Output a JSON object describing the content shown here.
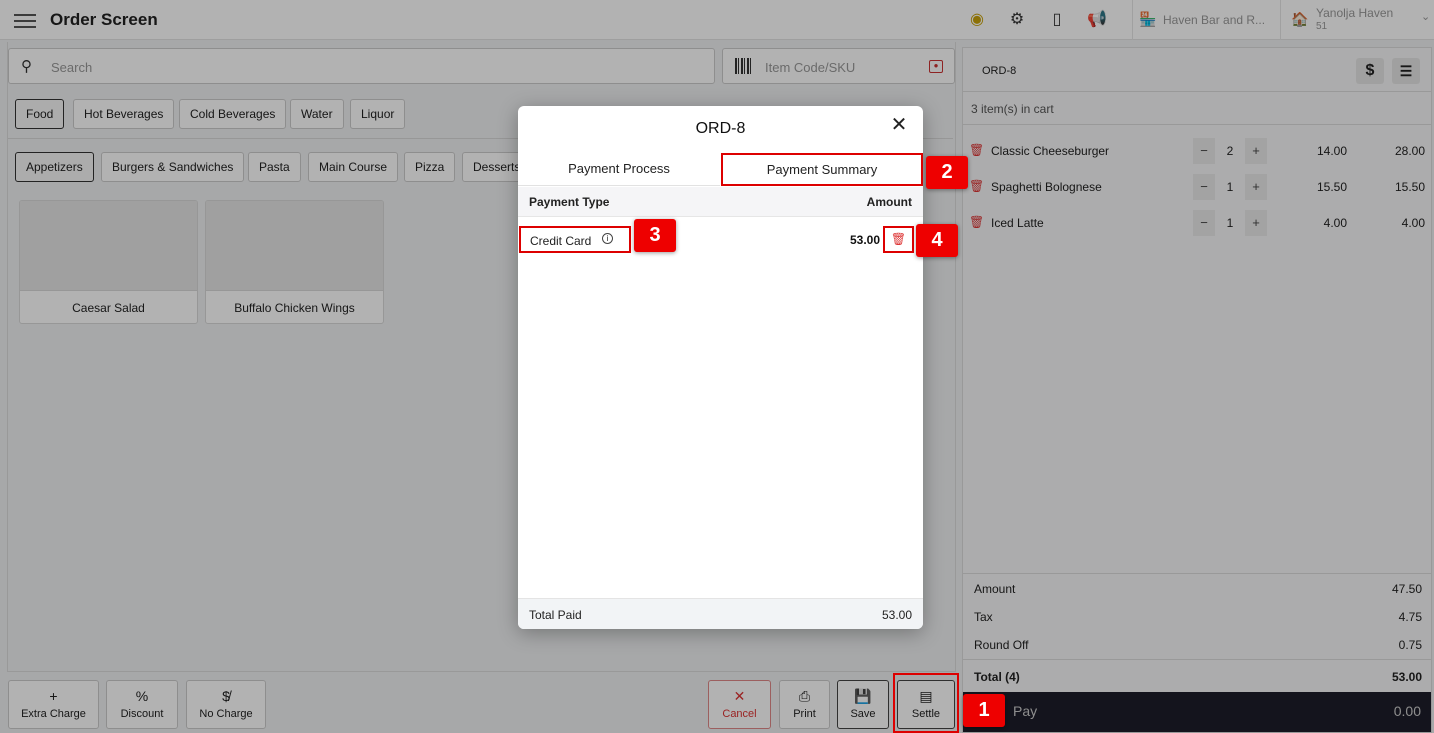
{
  "header": {
    "title": "Order Screen",
    "venue": "Haven Bar and R...",
    "property_name": "Yanolja Haven",
    "property_code": "51"
  },
  "search": {
    "placeholder": "Search",
    "sku_placeholder": "Item Code/SKU"
  },
  "categories": [
    "Food",
    "Hot Beverages",
    "Cold Beverages",
    "Water",
    "Liquor"
  ],
  "subcategories": [
    "Appetizers",
    "Burgers & Sandwiches",
    "Pasta",
    "Main Course",
    "Pizza",
    "Desserts"
  ],
  "products": [
    "Caesar Salad",
    "Buffalo Chicken Wings"
  ],
  "actions": {
    "extra_charge": "Extra Charge",
    "discount": "Discount",
    "no_charge": "No Charge",
    "cancel": "Cancel",
    "print": "Print",
    "save": "Save",
    "settle": "Settle"
  },
  "cart": {
    "order_id": "ORD-8",
    "count_text": "3 item(s) in cart",
    "items": [
      {
        "name": "Classic Cheeseburger",
        "qty": "2",
        "price": "14.00",
        "total": "28.00"
      },
      {
        "name": "Spaghetti Bolognese",
        "qty": "1",
        "price": "15.50",
        "total": "15.50"
      },
      {
        "name": "Iced Latte",
        "qty": "1",
        "price": "4.00",
        "total": "4.00"
      }
    ],
    "amount_label": "Amount",
    "amount": "47.50",
    "tax_label": "Tax",
    "tax": "4.75",
    "round_label": "Round Off",
    "round": "0.75",
    "total_label": "Total (4)",
    "total": "53.00",
    "pay_label": "Pay",
    "pay_amount": "0.00"
  },
  "modal": {
    "title": "ORD-8",
    "tab_process": "Payment Process",
    "tab_summary": "Payment Summary",
    "col_type": "Payment Type",
    "col_amount": "Amount",
    "payment_type": "Credit Card",
    "payment_amount": "53.00",
    "total_label": "Total Paid",
    "total_value": "53.00"
  },
  "callouts": [
    "1",
    "2",
    "3",
    "4"
  ],
  "colors": {
    "highlight": "#dd0000",
    "pay_bar": "#1e1e2a"
  }
}
